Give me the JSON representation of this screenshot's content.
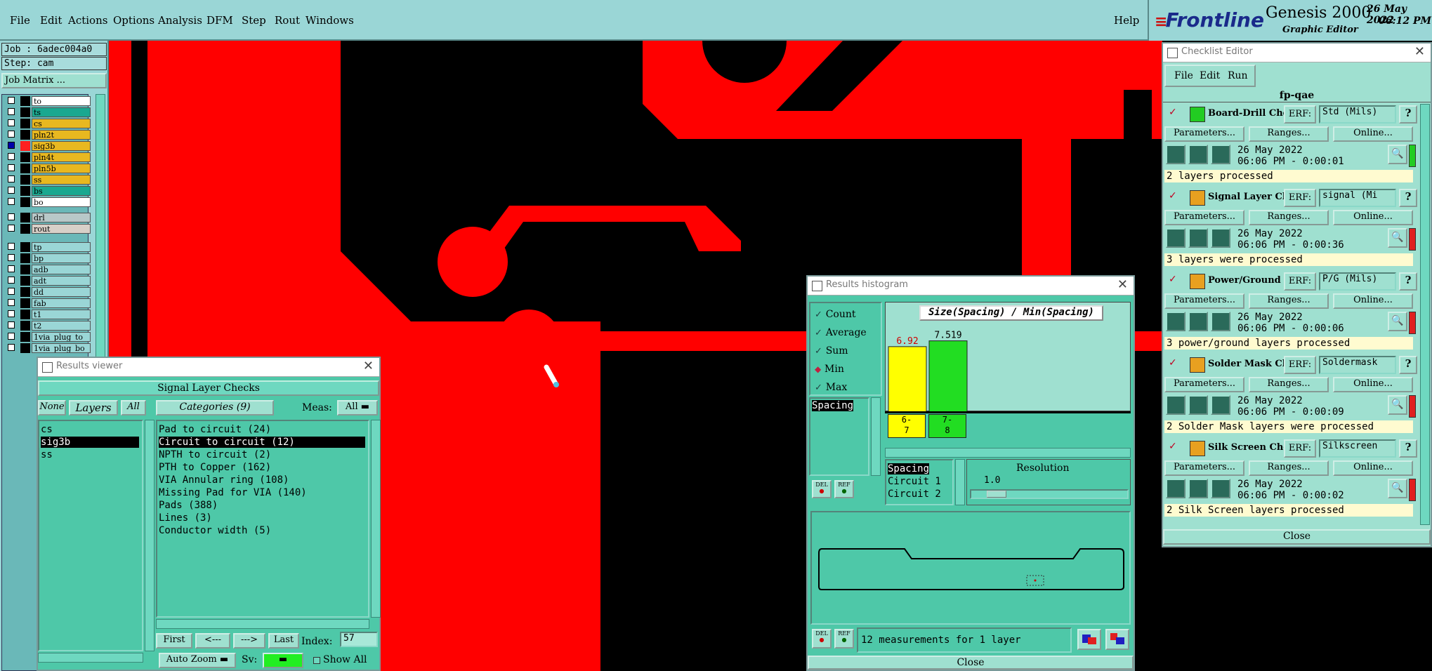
{
  "menubar": {
    "items": [
      "File",
      "Edit",
      "Actions",
      "Options",
      "Analysis",
      "DFM",
      "Step",
      "Rout",
      "Windows"
    ],
    "help": "Help"
  },
  "brand": {
    "logo": "Frontline",
    "product": "Genesis 2000",
    "subtitle": "Graphic Editor",
    "date": "26 May 2022",
    "time": "06:12 PM"
  },
  "left_panel": {
    "job": "Job : 6adec004a0",
    "step": "Step: cam",
    "job_matrix": "Job Matrix ...",
    "layers_group1": [
      {
        "name": "to",
        "color": "#ffffff"
      },
      {
        "name": "ts",
        "color": "#1aa890"
      },
      {
        "name": "cs",
        "color": "#e8b820"
      },
      {
        "name": "pln2t",
        "color": "#e8b820"
      },
      {
        "name": "sig3b",
        "color": "#e8b820"
      },
      {
        "name": "pln4t",
        "color": "#e8b820"
      },
      {
        "name": "pln5b",
        "color": "#e8b820"
      },
      {
        "name": "ss",
        "color": "#e8b820"
      },
      {
        "name": "bs",
        "color": "#1aa890"
      },
      {
        "name": "bo",
        "color": "#ffffff"
      }
    ],
    "layers_group2": [
      {
        "name": "drl",
        "color": "#b8c8c8"
      },
      {
        "name": "rout",
        "color": "#d8d0c8"
      }
    ],
    "layers_group3": [
      {
        "name": "tp",
        "color": "#9ad6d6"
      },
      {
        "name": "bp",
        "color": "#9ad6d6"
      },
      {
        "name": "adb",
        "color": "#9ad6d6"
      },
      {
        "name": "adt",
        "color": "#9ad6d6"
      },
      {
        "name": "dd",
        "color": "#9ad6d6"
      },
      {
        "name": "fab",
        "color": "#9ad6d6"
      },
      {
        "name": "t1",
        "color": "#9ad6d6"
      },
      {
        "name": "t2",
        "color": "#9ad6d6"
      },
      {
        "name": "1via_plug_to",
        "color": "#9ad6d6"
      },
      {
        "name": "1via_plug_bo",
        "color": "#9ad6d6"
      }
    ]
  },
  "results_viewer": {
    "title": "Results viewer",
    "header": "Signal Layer Checks",
    "btn_none": "None",
    "btn_layers": "Layers",
    "btn_all": "All",
    "categories_label": "Categories (9)",
    "meas_label": "Meas:",
    "meas_value": "All",
    "layers": [
      "cs",
      "sig3b",
      "ss"
    ],
    "selected_layer": 1,
    "categories": [
      "Pad to circuit (24)",
      "Circuit to circuit (12)",
      "NPTH to circuit (2)",
      "PTH to Copper (162)",
      "VIA Annular ring (108)",
      "Missing Pad for VIA (140)",
      "Pads (388)",
      "Lines (3)",
      "Conductor width (5)"
    ],
    "selected_category": 1,
    "nav": {
      "first": "First",
      "prev": "<---",
      "next": "--->",
      "last": "Last",
      "index_label": "Index:",
      "index_value": "57"
    },
    "auto_zoom": "Auto Zoom",
    "sv_label": "Sv:",
    "show_all": "Show All"
  },
  "histogram": {
    "title": "Results histogram",
    "options": [
      {
        "label": "Count",
        "mark": "check"
      },
      {
        "label": "Average",
        "mark": "check"
      },
      {
        "label": "Sum",
        "mark": "check"
      },
      {
        "label": "Min",
        "mark": "diamond"
      },
      {
        "label": "Max",
        "mark": "check"
      }
    ],
    "list_item": "Spacing",
    "del": "DEL",
    "ref": "REF",
    "chart_label": "Size(Spacing) / Min(Spacing)",
    "bars": [
      {
        "label": "6.92",
        "bin": "6-\n7",
        "color": "#ffff00",
        "value": 6.92,
        "label_color": "#d00000"
      },
      {
        "label": "7.519",
        "bin": "7-\n8",
        "color": "#22dd22",
        "value": 7.519,
        "label_color": "#000000"
      }
    ],
    "attr_list": [
      "Spacing",
      "Circuit 1",
      "Circuit 2"
    ],
    "resolution_label": "Resolution",
    "resolution_value": "1.0",
    "status": "12 measurements for 1 layer",
    "close": "Close"
  },
  "checklist": {
    "title": "Checklist Editor",
    "menu": [
      "File",
      "Edit",
      "Run"
    ],
    "name": "fp-qae",
    "erf_label": "ERF:",
    "param_btn": "Parameters...",
    "ranges_btn": "Ranges...",
    "online_btn": "Online...",
    "help_btn": "?",
    "items": [
      {
        "name": "Board-Drill Che",
        "erf": "Std (Mils)",
        "date": "26 May 2022",
        "time": "06:06 PM - 0:00:01",
        "result": "2 layers processed",
        "status_color": "#22cc22"
      },
      {
        "name": "Signal Layer Ch",
        "erf": "signal (Mi",
        "date": "26 May 2022",
        "time": "06:06 PM - 0:00:36",
        "result": "3 layers were processed",
        "status_color": "#e02020"
      },
      {
        "name": "Power/Ground C",
        "erf": "P/G (Mils)",
        "date": "26 May 2022",
        "time": "06:06 PM - 0:00:06",
        "result": "3 power/ground layers processed",
        "status_color": "#e02020"
      },
      {
        "name": "Solder Mask Ch",
        "erf": "Soldermask",
        "date": "26 May 2022",
        "time": "06:06 PM - 0:00:09",
        "result": "2 Solder Mask layers were processed",
        "status_color": "#e02020"
      },
      {
        "name": "Silk Screen Che",
        "erf": "Silkscreen",
        "date": "26 May 2022",
        "time": "06:06 PM - 0:00:02",
        "result": "2 Silk Screen layers processed",
        "status_color": "#e02020"
      }
    ],
    "close": "Close"
  }
}
